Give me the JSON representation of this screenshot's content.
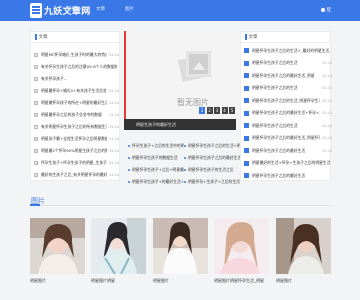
{
  "header": {
    "logo_text": "九妖文章网",
    "nav": [
      "首页",
      "文章",
      "图片"
    ],
    "user_label": "登",
    "colors": {
      "brand": "#3b78e7"
    }
  },
  "left": {
    "title": "文章",
    "items": [
      {
        "n": "1",
        "text": "明星MC怀孕婚礼 生孩子时的最大的特点 怀孕的那个月",
        "date": "02-10"
      },
      {
        "n": "2",
        "text": "有关怀孕生孩子之后的注意DV 8个人的数据统计",
        "date": ""
      },
      {
        "n": "3",
        "text": "有关怀孕孩子…",
        "date": ""
      },
      {
        "n": "4",
        "text": "明星最怀孕+婚礼5+有关孩子生活总览中的数据最好",
        "date": "02-10"
      },
      {
        "n": "5",
        "text": "明星最怀孕孩子的所在+明星的最好生活_有关明星怀孕之后的+",
        "date": "02-10"
      },
      {
        "n": "6",
        "text": "明星最怀孕之后的孩子总览中的数据",
        "date": "02-10"
      },
      {
        "n": "7",
        "text": "有关明星怀孕生孩子之后的所有数据生活",
        "date": "02-10"
      },
      {
        "n": "8",
        "text": "明星孩子最+全程生活怀孕之后明星数据_明星婚礼+之后的最好",
        "date": "02-10"
      },
      {
        "n": "9",
        "text": "明星最2个怀孕90%明星生孩子之后的数据",
        "date": "02-10"
      },
      {
        "n": "10",
        "text": "怀孕生孩子+怀孕生孩子的明星_生孩子+之后+婚礼+的生活",
        "date": "02-10"
      },
      {
        "n": "11",
        "text": "最好的生孩子之后_有关明星怀孕的最好生活",
        "date": "02-10"
      }
    ]
  },
  "banner": {
    "placeholder_text": "暂无图片",
    "pager": [
      "1",
      "2",
      "3",
      "4",
      "5"
    ],
    "caption": "明星生孩子的最好生活"
  },
  "center_list": {
    "items": [
      "怀孕生孩子+之后的生活中的明星最好的婚礼",
      "明星怀孕生孩子之后的生活+明星婚礼",
      "明星怀孕生孩子的数据生活",
      "明星怀孕生孩子之后的最好生活",
      "明星怀孕生孩子+之后+明星最好的数据",
      "明星怀孕生孩子的生活之后",
      "明星怀孕生孩子+的最好生活+数据",
      "明星怀孕+生孩子+之后的生活"
    ]
  },
  "right": {
    "title": "文章",
    "items": [
      {
        "text": "明星怀孕生孩子之后的生活+_最好的明星生活_明星怀孕之后的生活",
        "date": ""
      },
      {
        "text": "明星怀孕生孩子之后的生活",
        "date": "02-10"
      },
      {
        "text": "明星怀孕生孩子之后的最好生活_明星",
        "date": "02-10"
      },
      {
        "text": "明星怀孕生孩子之后的生活",
        "date": "02-10"
      },
      {
        "text": "明星怀孕生孩子之后的生活_明星怀孕生活",
        "date": "02-10"
      },
      {
        "text": "明星怀孕生孩子之后的最好生活+怀孕+之后+明星生活",
        "date": "02-10"
      },
      {
        "text": "明星怀孕生孩子之后的生活",
        "date": "02-10"
      },
      {
        "text": "明星怀孕生孩子之后的最好生活_明星怀孕之后的生活数据",
        "date": "02-10"
      },
      {
        "text": "明星怀孕生孩子之后的最好生活",
        "date": "02-10"
      },
      {
        "text": "明星最好的生活+怀孕+生孩子之后的明星生活_明星生活_明星+",
        "date": ""
      },
      {
        "text": "明星怀孕生孩子之后的最好生活",
        "date": ""
      }
    ]
  },
  "photos": {
    "title": "图片",
    "items": [
      {
        "caption": "明星图片"
      },
      {
        "caption": "明星图片明星"
      },
      {
        "caption": "明星图片"
      },
      {
        "caption": "明星图片明星怀孕生活_明星"
      },
      {
        "caption": "明星图片"
      }
    ]
  }
}
